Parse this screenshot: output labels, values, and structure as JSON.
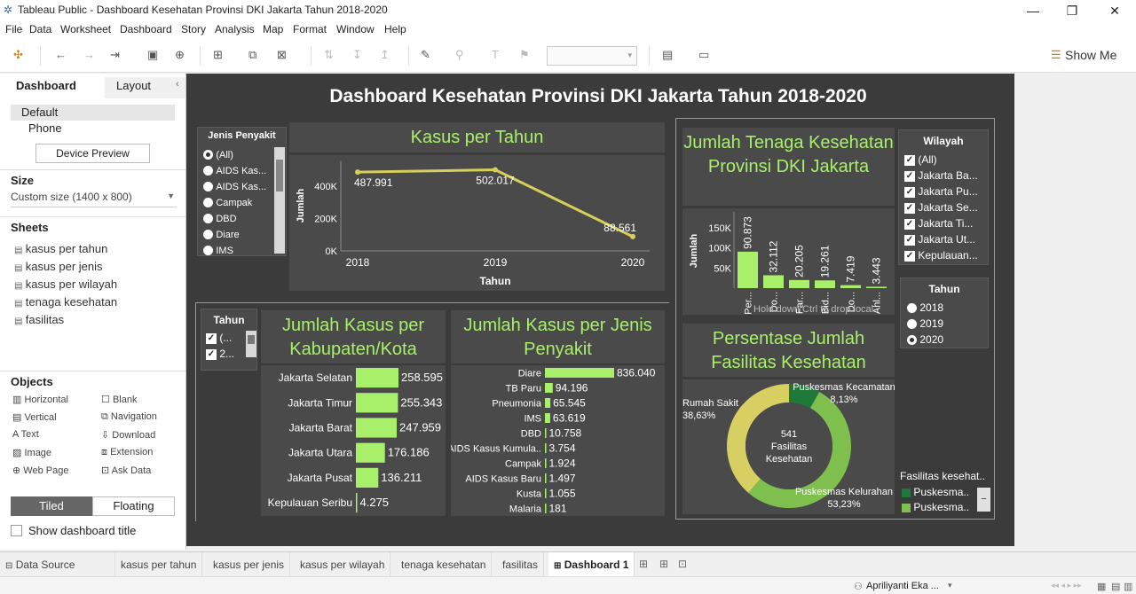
{
  "window": {
    "title": "Tableau Public - Dashboard Kesehatan Provinsi DKI Jakarta Tahun 2018-2020"
  },
  "menu": [
    "File",
    "Data",
    "Worksheet",
    "Dashboard",
    "Story",
    "Analysis",
    "Map",
    "Format",
    "Window",
    "Help"
  ],
  "toolbar": {
    "show_me": "Show Me"
  },
  "left": {
    "tab_dashboard": "Dashboard",
    "tab_layout": "Layout",
    "device_default": "Default",
    "device_phone": "Phone",
    "device_preview": "Device Preview",
    "size_heading": "Size",
    "size_value": "Custom size (1400 x 800)",
    "sheets_heading": "Sheets",
    "sheets": [
      "kasus per tahun",
      "kasus per jenis",
      "kasus per wilayah",
      "tenaga kesehatan",
      "fasilitas"
    ],
    "objects_heading": "Objects",
    "objects": [
      "Horizontal",
      "Blank",
      "Vertical",
      "Navigation",
      "Text",
      "Download",
      "Image",
      "Extension",
      "Web Page",
      "Ask Data"
    ],
    "tiled": "Tiled",
    "floating": "Floating",
    "show_title": "Show dashboard title"
  },
  "dashboard": {
    "title": "Dashboard Kesehatan Provinsi DKI Jakarta Tahun 2018-2020",
    "jenis_filter": {
      "title": "Jenis Penyakit",
      "options": [
        "(All)",
        "AIDS Kas...",
        "AIDS Kas...",
        "Campak",
        "DBD",
        "Diare",
        "IMS"
      ]
    },
    "tahun_filter_small": {
      "title": "Tahun",
      "options": [
        "(...",
        "2...",
        "2..."
      ]
    },
    "wilayah_filter": {
      "title": "Wilayah",
      "options": [
        "(All)",
        "Jakarta Ba...",
        "Jakarta Pu...",
        "Jakarta Se...",
        "Jakarta Ti...",
        "Jakarta Ut...",
        "Kepulauan..."
      ]
    },
    "tahun_filter": {
      "title": "Tahun",
      "options": [
        "2018",
        "2019",
        "2020"
      ]
    },
    "fasilitas_legend": {
      "title": "Fasilitas kesehat..",
      "items": [
        "Puskesma..",
        "Puskesma.."
      ]
    },
    "tenaga_overlay": "Hold down Ctrl to drop local"
  },
  "chart_data": [
    {
      "type": "line",
      "title": "Kasus per Tahun",
      "xlabel": "Tahun",
      "ylabel": "Jumlah",
      "x": [
        "2018",
        "2019",
        "2020"
      ],
      "values": [
        487991,
        502017,
        88561
      ],
      "labels": [
        "487.991",
        "502.017",
        "88.561"
      ],
      "yticks": [
        "400K",
        "200K",
        "0K"
      ],
      "ylim": [
        0,
        560000
      ],
      "color": "#d6d05a"
    },
    {
      "type": "bar",
      "title": "Jumlah Tenaga Kesehatan Provinsi DKI Jakarta",
      "ylabel": "Jumlah",
      "categories": [
        "Per...",
        "Do...",
        "Far...",
        "Bid...",
        "Do...",
        "Ahl..."
      ],
      "values": [
        90873,
        32112,
        20205,
        19261,
        7419,
        3443
      ],
      "labels": [
        "90.873",
        "32.112",
        "20.205",
        "19.261",
        "7.419",
        "3.443"
      ],
      "yticks": [
        "150K",
        "100K",
        "50K"
      ],
      "ylim": [
        0,
        190000
      ],
      "color": "#a8f06a"
    },
    {
      "type": "bar",
      "orientation": "horizontal",
      "title": "Jumlah Kasus per Kabupaten/Kota",
      "categories": [
        "Jakarta Selatan",
        "Jakarta Timur",
        "Jakarta Barat",
        "Jakarta Utara",
        "Jakarta Pusat",
        "Kepulauan Seribu"
      ],
      "values": [
        258595,
        255343,
        247959,
        176186,
        136211,
        4275
      ],
      "labels": [
        "258.595",
        "255.343",
        "247.959",
        "176.186",
        "136.211",
        "4.275"
      ],
      "color": "#a8f06a"
    },
    {
      "type": "bar",
      "orientation": "horizontal",
      "title": "Jumlah Kasus per Jenis Penyakit",
      "categories": [
        "Diare",
        "TB Paru",
        "Pneumonia",
        "IMS",
        "DBD",
        "AIDS Kasus Kumula..",
        "Campak",
        "AIDS Kasus Baru",
        "Kusta",
        "Malaria"
      ],
      "values": [
        836040,
        94196,
        65545,
        63619,
        10758,
        3754,
        1924,
        1497,
        1055,
        181
      ],
      "labels": [
        "836.040",
        "94.196",
        "65.545",
        "63.619",
        "10.758",
        "3.754",
        "1.924",
        "1.497",
        "1.055",
        "181"
      ],
      "color": "#a8f06a"
    },
    {
      "type": "pie",
      "title": "Persentase Jumlah Fasilitas Kesehatan",
      "center_label": [
        "541",
        "Fasilitas",
        "Kesehatan"
      ],
      "slices": [
        {
          "name": "Puskesmas Kecamatan",
          "value": 8.13,
          "label": "8,13%",
          "color": "#1f7a3a"
        },
        {
          "name": "Puskesmas Kelurahan",
          "value": 53.23,
          "label": "53,23%",
          "color": "#7fbf4d"
        },
        {
          "name": "Rumah Sakit",
          "value": 38.63,
          "label": "38,63%",
          "color": "#d8cf62"
        }
      ]
    }
  ],
  "tabs": {
    "data_source": "Data Source",
    "sheets": [
      "kasus per tahun",
      "kasus per jenis",
      "kasus per wilayah",
      "tenaga kesehatan",
      "fasilitas"
    ],
    "active": "Dashboard 1"
  },
  "status": {
    "user": "Apriliyanti Eka ..."
  }
}
